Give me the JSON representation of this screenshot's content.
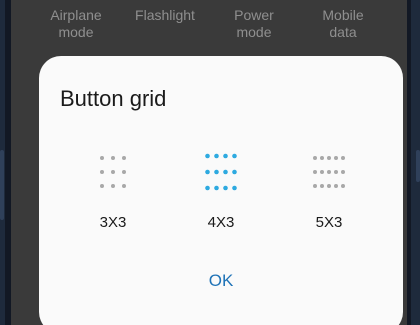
{
  "quick_settings": {
    "items": [
      {
        "label": "Airplane\nmode"
      },
      {
        "label": "Flashlight"
      },
      {
        "label": "Power\nmode"
      },
      {
        "label": "Mobile\ndata"
      }
    ]
  },
  "dialog": {
    "title": "Button grid",
    "options": [
      {
        "label": "3X3",
        "columns": 3,
        "rows": 3,
        "selected": false,
        "icon": "grid-3x3-icon"
      },
      {
        "label": "4X3",
        "columns": 4,
        "rows": 3,
        "selected": true,
        "icon": "grid-4x3-icon"
      },
      {
        "label": "5X3",
        "columns": 5,
        "rows": 3,
        "selected": false,
        "icon": "grid-5x3-icon"
      }
    ],
    "ok_label": "OK"
  },
  "colors": {
    "selected_dot": "#2eaae0",
    "unselected_dot": "#a8a8a8",
    "accent": "#1f73b7"
  }
}
